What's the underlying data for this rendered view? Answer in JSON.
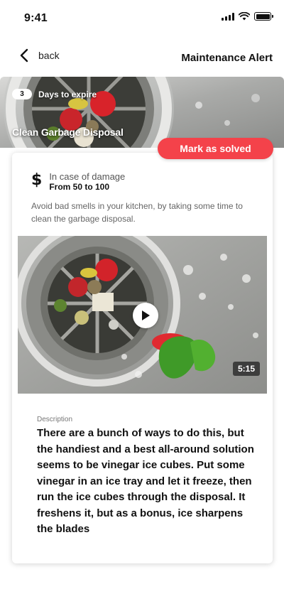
{
  "status_bar": {
    "time": "9:41",
    "icons": [
      "signal-icon",
      "wifi-icon",
      "battery-icon"
    ]
  },
  "nav": {
    "back_label": "back",
    "title": "Maintenance Alert"
  },
  "hero": {
    "days_count": "3",
    "days_label": "Days to expire",
    "title": "Clean Garbage Disposal"
  },
  "actions": {
    "solve_label": "Mark as solved"
  },
  "damage": {
    "icon": "dollar-icon",
    "caption": "In case of damage",
    "value": "From 50 to 100"
  },
  "summary": "Avoid bad smells in your kitchen, by taking some time to clean the garbage disposal.",
  "video": {
    "duration": "5:15",
    "icon": "play-icon"
  },
  "description": {
    "label": "Description",
    "text": "There are a bunch of ways to do this, but the handiest and a best all-around solution seems to be vinegar ice cubes. Put some vinegar in an ice tray and let it freeze, then run the ice cubes through the disposal. It freshens it, but as a bonus, ice sharpens the blades"
  },
  "colors": {
    "accent": "#f4424a",
    "text": "#111111",
    "muted": "#666666"
  }
}
